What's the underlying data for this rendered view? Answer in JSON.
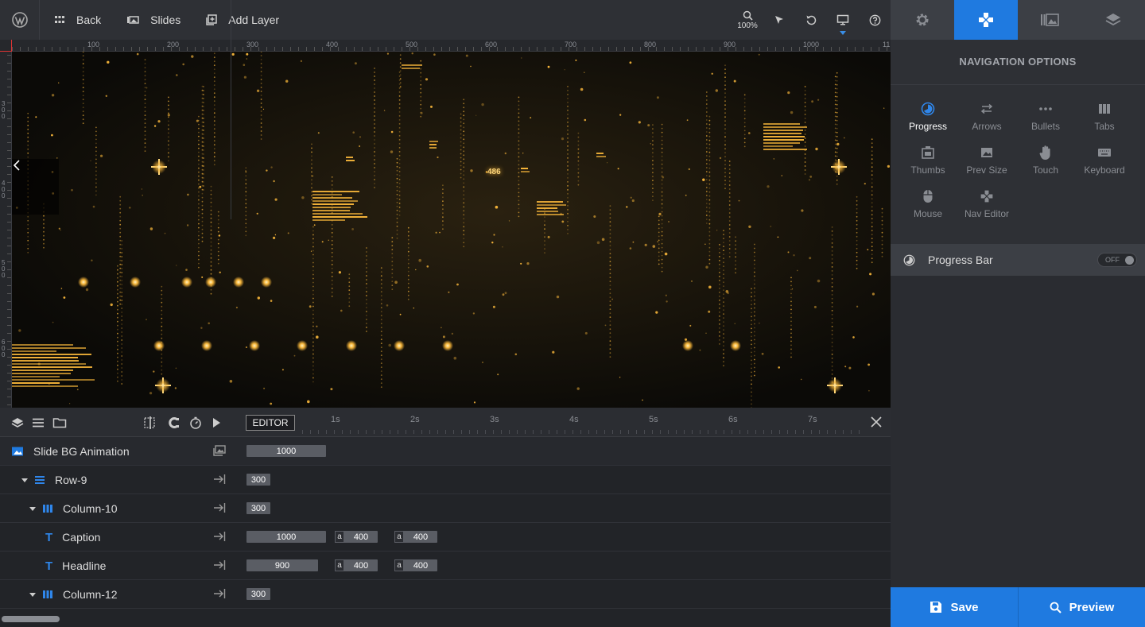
{
  "toolbar": {
    "back_label": "Back",
    "slides_label": "Slides",
    "add_layer_label": "Add Layer",
    "zoom_value": "100%"
  },
  "ruler": {
    "top_labels": [
      "100",
      "200",
      "300",
      "400",
      "500",
      "600",
      "700",
      "800",
      "900",
      "1000",
      "11"
    ],
    "left_labels": [
      "300",
      "400",
      "500",
      "600"
    ]
  },
  "canvas": {
    "counter_text": "486"
  },
  "timeline": {
    "editor_label": "EDITOR",
    "time_marks": [
      "1s",
      "2s",
      "3s",
      "4s",
      "5s",
      "6s",
      "7s"
    ],
    "rows": [
      {
        "name": "Slide BG Animation",
        "icon": "image-icon",
        "bars": [
          "1000"
        ]
      },
      {
        "name": "Row-9",
        "icon": "rows-icon",
        "bars": [
          "300"
        ]
      },
      {
        "name": "Column-10",
        "icon": "columns-icon",
        "bars": [
          "300"
        ]
      },
      {
        "name": "Caption",
        "icon": "text-icon",
        "bars": [
          "1000"
        ],
        "abars": [
          "400",
          "400"
        ]
      },
      {
        "name": "Headline",
        "icon": "text-icon",
        "bars": [
          "900"
        ],
        "abars": [
          "400",
          "400"
        ]
      },
      {
        "name": "Column-12",
        "icon": "columns-icon",
        "bars": [
          "300"
        ]
      }
    ],
    "abar_prefix": "a"
  },
  "panel": {
    "title": "NAVIGATION OPTIONS",
    "options": [
      {
        "label": "Progress",
        "icon": "progress-icon",
        "active": true
      },
      {
        "label": "Arrows",
        "icon": "arrows-icon"
      },
      {
        "label": "Bullets",
        "icon": "bullets-icon"
      },
      {
        "label": "Tabs",
        "icon": "tabs-icon"
      },
      {
        "label": "Thumbs",
        "icon": "thumbs-icon"
      },
      {
        "label": "Prev Size",
        "icon": "image-icon"
      },
      {
        "label": "Touch",
        "icon": "hand-icon"
      },
      {
        "label": "Keyboard",
        "icon": "keyboard-icon"
      },
      {
        "label": "Mouse",
        "icon": "mouse-icon"
      },
      {
        "label": "Nav Editor",
        "icon": "gamepad-icon"
      }
    ],
    "progress_bar_label": "Progress Bar",
    "toggle_label": "OFF"
  },
  "footer": {
    "save_label": "Save",
    "preview_label": "Preview"
  },
  "colors": {
    "accent": "#1f7ae0",
    "canvas_glow": "#f6b53a"
  }
}
